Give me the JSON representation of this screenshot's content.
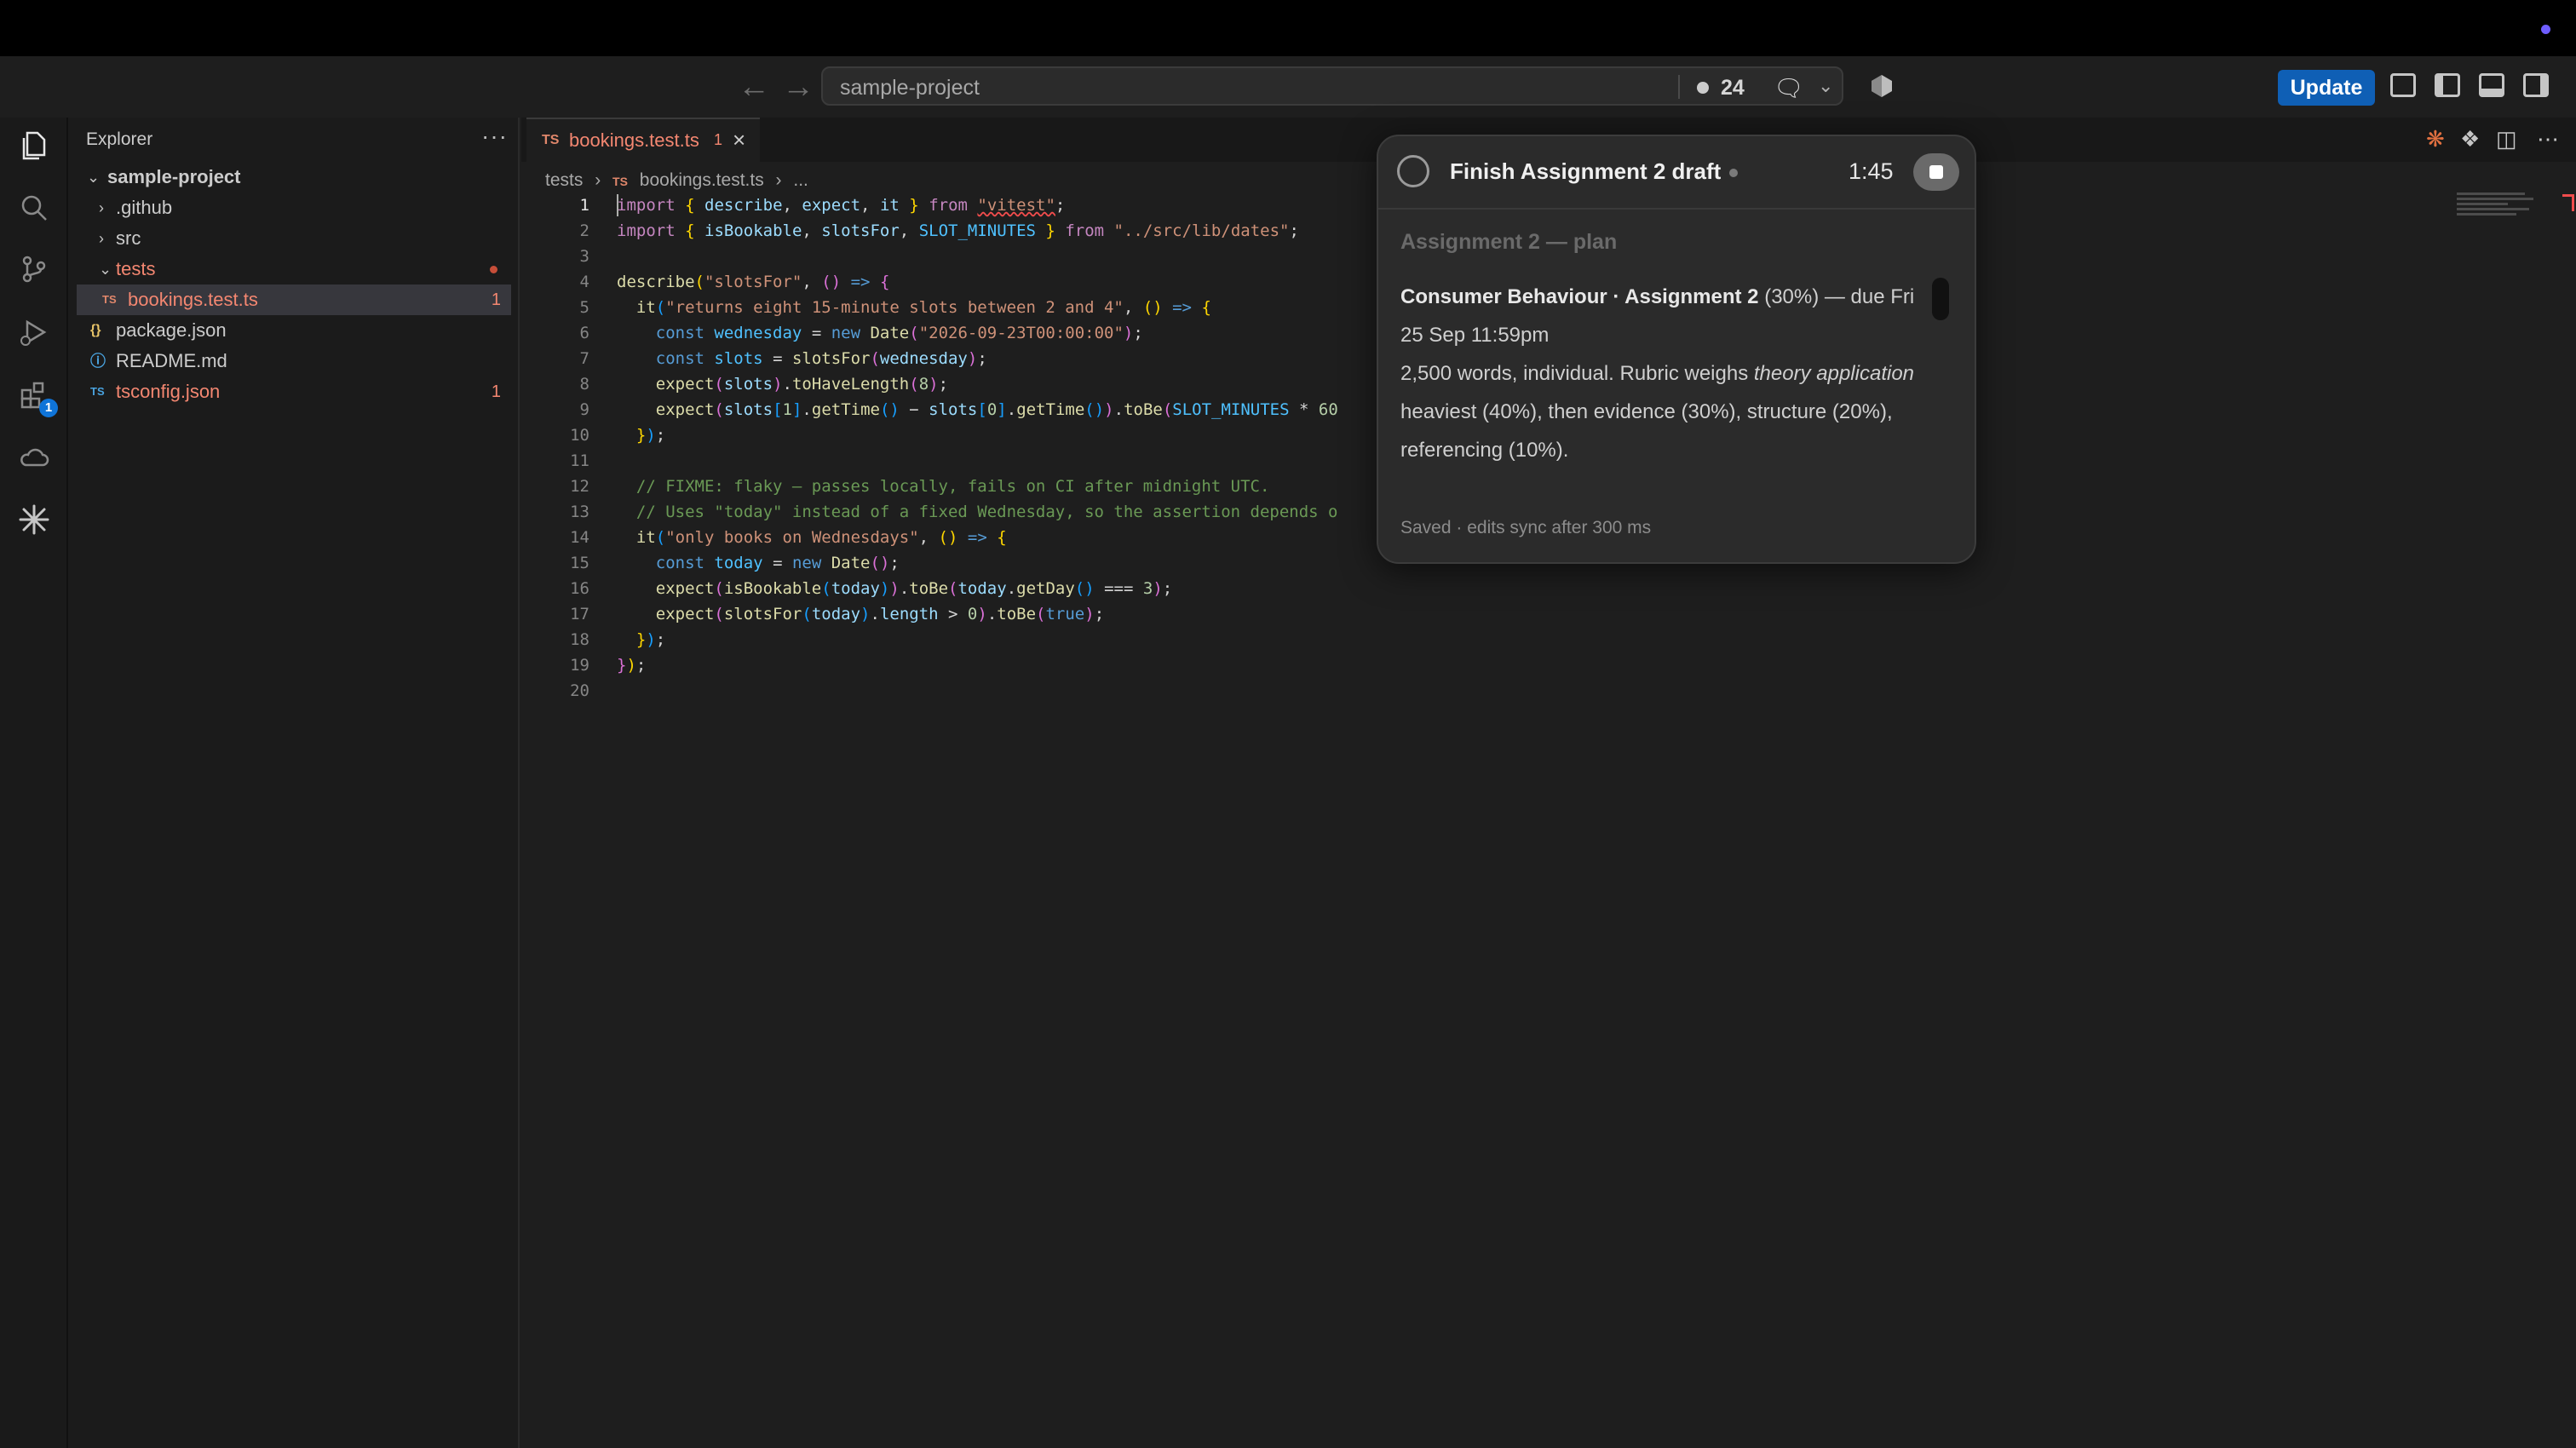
{
  "titlebar": {
    "project": "sample-project",
    "count": "24",
    "update_label": "Update"
  },
  "activity": {
    "extensions_badge": "1"
  },
  "explorer": {
    "title": "Explorer",
    "more": "···",
    "root": "sample-project",
    "items": [
      {
        "label": ".github",
        "type": "folder"
      },
      {
        "label": "src",
        "type": "folder"
      },
      {
        "label": "tests",
        "type": "folder-open"
      },
      {
        "label": "bookings.test.ts",
        "type": "ts",
        "count": "1"
      },
      {
        "label": "package.json",
        "type": "json"
      },
      {
        "label": "README.md",
        "type": "info"
      },
      {
        "label": "tsconfig.json",
        "type": "tsconfig",
        "count": "1"
      }
    ]
  },
  "editor": {
    "tab": {
      "icon": "TS",
      "name": "bookings.test.ts",
      "problems": "1"
    },
    "breadcrumb": {
      "folder": "tests",
      "icon": "TS",
      "file": "bookings.test.ts",
      "ellipsis": "..."
    },
    "line_numbers": [
      "1",
      "2",
      "3",
      "4",
      "5",
      "6",
      "7",
      "8",
      "9",
      "10",
      "11",
      "12",
      "13",
      "14",
      "15",
      "16",
      "17",
      "18",
      "19",
      "20"
    ]
  },
  "timer": {
    "title": "Finish Assignment 2 draft",
    "time": "1:45",
    "heading": "Assignment 2 — plan",
    "course_bold": "Consumer Behaviour · Assignment 2",
    "course_rest": " (30%) — due Fri 25 Sep 11:59pm",
    "para_start": "2,500 words, individual. Rubric weighs ",
    "para_italic": "theory application",
    "para_end": " heaviest (40%), then evidence (30%), structure (20%), referencing (10%).",
    "status": "Saved · edits sync after 300 ms"
  },
  "colors": {
    "accent": "#0f5fb5",
    "error": "#f48771",
    "ts_icon": "#e0876b"
  }
}
